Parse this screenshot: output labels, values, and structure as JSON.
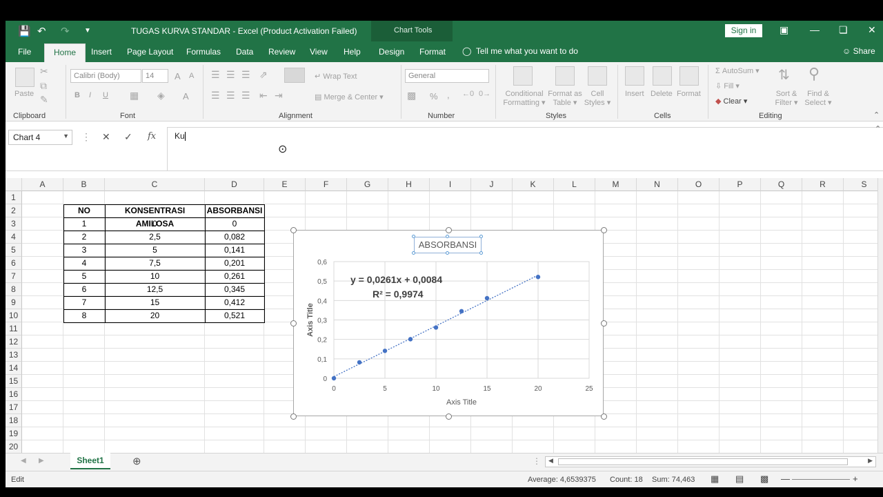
{
  "window": {
    "title": "TUGAS KURVA STANDAR  -  Excel (Product Activation Failed)",
    "context_tab_group": "Chart Tools",
    "signin_label": "Sign in"
  },
  "tabs": [
    {
      "label": "File"
    },
    {
      "label": "Home"
    },
    {
      "label": "Insert"
    },
    {
      "label": "Page Layout"
    },
    {
      "label": "Formulas"
    },
    {
      "label": "Data"
    },
    {
      "label": "Review"
    },
    {
      "label": "View"
    },
    {
      "label": "Help"
    },
    {
      "label": "Design"
    },
    {
      "label": "Format"
    }
  ],
  "tell_me": "Tell me what you want to do",
  "share_label": "Share",
  "ribbon": {
    "clipboard": {
      "paste": "Paste",
      "label": "Clipboard"
    },
    "font": {
      "name": "Calibri (Body)",
      "size": "14",
      "bold": "B",
      "italic": "I",
      "underline": "U",
      "grow": "A",
      "shrink": "A",
      "color": "A",
      "label": "Font"
    },
    "alignment": {
      "wrap": "Wrap Text",
      "merge": "Merge & Center",
      "label": "Alignment"
    },
    "number": {
      "format": "General",
      "percent": "%",
      "comma": ",",
      "label": "Number"
    },
    "styles": {
      "conditional": [
        "Conditional",
        "Formatting"
      ],
      "table": [
        "Format as",
        "Table"
      ],
      "cell": [
        "Cell",
        "Styles"
      ],
      "label": "Styles"
    },
    "cells": {
      "insert": "Insert",
      "delete": "Delete",
      "format": "Format",
      "label": "Cells"
    },
    "editing": {
      "autosum": "AutoSum",
      "fill": "Fill",
      "clear": "Clear",
      "sort": [
        "Sort &",
        "Filter"
      ],
      "find": [
        "Find &",
        "Select"
      ],
      "label": "Editing"
    }
  },
  "formula_bar": {
    "name_box": "Chart 4",
    "value": "Ku"
  },
  "columns": [
    "A",
    "B",
    "C",
    "D",
    "E",
    "F",
    "G",
    "H",
    "I",
    "J",
    "K",
    "L",
    "M",
    "N",
    "O",
    "P",
    "Q",
    "R",
    "S"
  ],
  "rows": [
    "1",
    "2",
    "3",
    "4",
    "5",
    "6",
    "7",
    "8",
    "9",
    "10",
    "11",
    "12",
    "13",
    "14",
    "15",
    "16",
    "17",
    "18",
    "19",
    "20"
  ],
  "table": {
    "headers": [
      "NO",
      "KONSENTRASI AMILOSA",
      "ABSORBANSI"
    ],
    "rows": [
      [
        "1",
        "0",
        "0"
      ],
      [
        "2",
        "2,5",
        "0,082"
      ],
      [
        "3",
        "5",
        "0,141"
      ],
      [
        "4",
        "7,5",
        "0,201"
      ],
      [
        "5",
        "10",
        "0,261"
      ],
      [
        "6",
        "12,5",
        "0,345"
      ],
      [
        "7",
        "15",
        "0,412"
      ],
      [
        "8",
        "20",
        "0,521"
      ]
    ]
  },
  "chart_data": {
    "type": "scatter",
    "title": "ABSORBANSI",
    "xlabel": "Axis Title",
    "ylabel": "Axis Title",
    "x": [
      0,
      2.5,
      5,
      7.5,
      10,
      12.5,
      15,
      20
    ],
    "y": [
      0,
      0.082,
      0.141,
      0.201,
      0.261,
      0.345,
      0.412,
      0.521
    ],
    "xlim": [
      0,
      25
    ],
    "ylim": [
      0,
      0.6
    ],
    "x_ticks": [
      "0",
      "5",
      "10",
      "15",
      "20",
      "25"
    ],
    "y_ticks": [
      "0",
      "0,1",
      "0,2",
      "0,3",
      "0,4",
      "0,5",
      "0,6"
    ],
    "trendline": {
      "type": "linear",
      "slope": 0.0261,
      "intercept": 0.0084,
      "style": "dotted"
    },
    "equation": "y = 0,0261x + 0,0084",
    "r_squared": "R² = 0,9974",
    "series_color": "#4472c4",
    "grid": true
  },
  "sheet_tab": "Sheet1",
  "status": {
    "mode": "Edit",
    "average": "Average: 4,6539375",
    "count": "Count: 18",
    "sum": "Sum: 74,463"
  }
}
